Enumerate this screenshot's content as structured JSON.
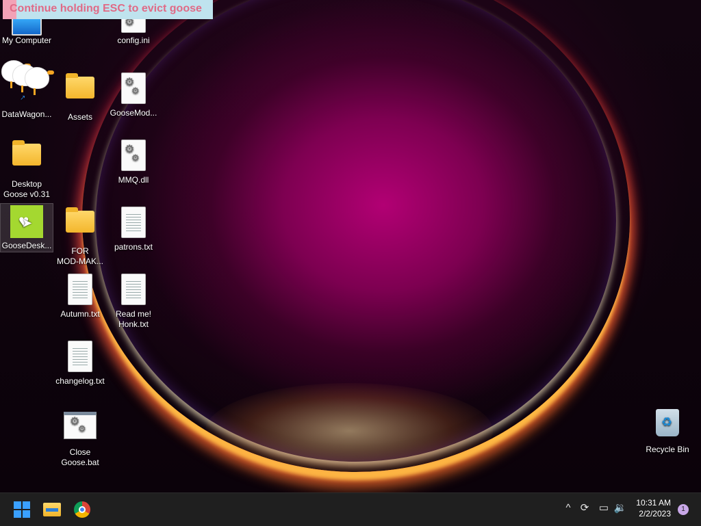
{
  "banner": {
    "text": "Continue holding ESC to evict goose"
  },
  "desktop": {
    "icons": {
      "my_computer": "My Computer",
      "config_ini": "config.ini",
      "datawagon": "DataWagon...",
      "assets": "Assets",
      "goosemod": "GooseMod...",
      "desktop_goose_l1": "Desktop",
      "desktop_goose_l2": "Goose v0.31",
      "mmq_dll": "MMQ.dll",
      "goosedesk": "GooseDesk...",
      "for_modmakers_l1": "FOR",
      "for_modmakers_l2": "MOD-MAK...",
      "patrons_txt": "patrons.txt",
      "autumn_txt": "Autumn.txt",
      "readme_l1": "Read me!",
      "readme_l2": "Honk.txt",
      "changelog_txt": "changelog.txt",
      "close_goose_l1": "Close",
      "close_goose_l2": "Goose.bat",
      "recycle_bin": "Recycle Bin"
    }
  },
  "taskbar": {
    "clock_time": "10:31 AM",
    "clock_date": "2/2/2023",
    "notification_count": "1",
    "tray_chevron": "^",
    "pinned": [
      "start-button",
      "file-explorer",
      "google-chrome"
    ]
  },
  "colors": {
    "accent": "#3aa0ff",
    "banner_bg": "#bfe3ee",
    "banner_text": "#e06a86",
    "taskbar_bg": "#1f1f1f"
  }
}
